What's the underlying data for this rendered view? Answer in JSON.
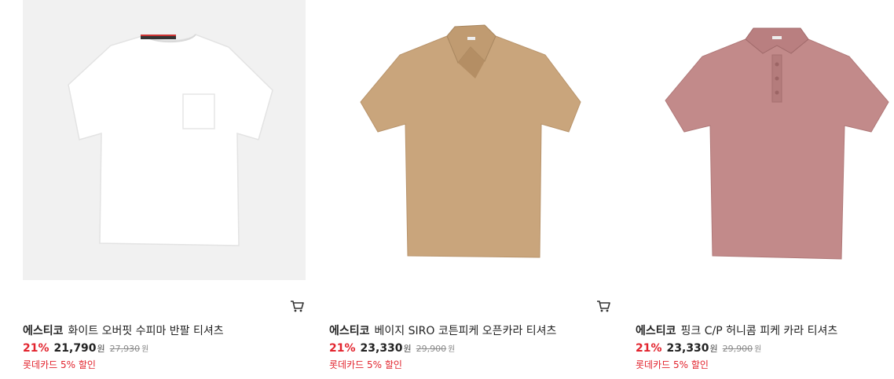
{
  "products": [
    {
      "brand": "에스티코",
      "name": "화이트 오버핏 수피마 반팔 티셔츠",
      "discount": "21%",
      "price": "21,790",
      "currency": "원",
      "original_price": "27,930",
      "original_currency": "원",
      "promo": "롯데카드 5% 할인",
      "image_color": "#ffffff",
      "icon": "cart-icon"
    },
    {
      "brand": "에스티코",
      "name": "베이지 SIRO 코튼피케 오픈카라 티셔츠",
      "discount": "21%",
      "price": "23,330",
      "currency": "원",
      "original_price": "29,900",
      "original_currency": "원",
      "promo": "롯데카드 5% 할인",
      "image_color": "#c9a57c",
      "icon": "cart-icon"
    },
    {
      "brand": "에스티코",
      "name": "핑크 C/P 허니콤 피케 카라 티셔츠",
      "discount": "21%",
      "price": "23,330",
      "currency": "원",
      "original_price": "29,900",
      "original_currency": "원",
      "promo": "롯데카드 5% 할인",
      "image_color": "#c28a8a"
    }
  ],
  "colors": {
    "discount": "#e2242e",
    "promo": "#e2242e",
    "strike": "#8a8a8a"
  }
}
